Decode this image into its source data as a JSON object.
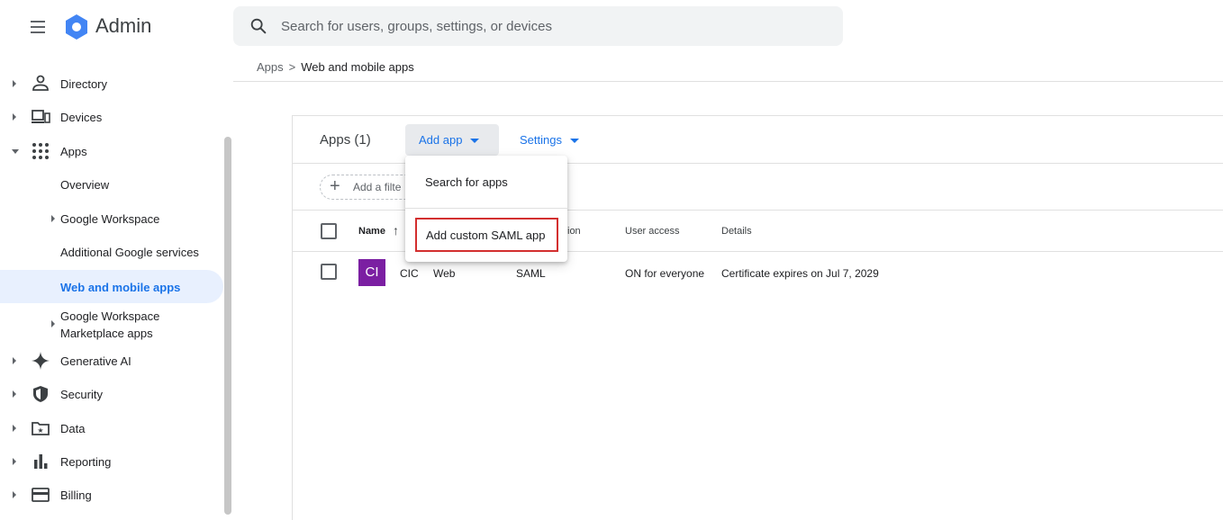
{
  "header": {
    "brand": "Admin",
    "search_placeholder": "Search for users, groups, settings, or devices"
  },
  "sidebar": {
    "items": [
      {
        "label": "Directory",
        "icon": "person-icon"
      },
      {
        "label": "Devices",
        "icon": "devices-icon"
      },
      {
        "label": "Apps",
        "icon": "apps-grid-icon",
        "expanded": true
      },
      {
        "label": "Generative AI",
        "icon": "sparkle-icon"
      },
      {
        "label": "Security",
        "icon": "shield-icon"
      },
      {
        "label": "Data",
        "icon": "data-folder-icon"
      },
      {
        "label": "Reporting",
        "icon": "bar-chart-icon"
      },
      {
        "label": "Billing",
        "icon": "billing-card-icon"
      }
    ],
    "apps_sub": [
      {
        "label": "Overview"
      },
      {
        "label": "Google Workspace"
      },
      {
        "label": "Additional Google services"
      },
      {
        "label": "Web and mobile apps",
        "active": true
      },
      {
        "label_line1": "Google Workspace",
        "label_line2": "Marketplace apps"
      }
    ]
  },
  "breadcrumb": {
    "parent": "Apps",
    "separator": ">",
    "current": "Web and mobile apps"
  },
  "apps_panel": {
    "count_label": "Apps (1)",
    "add_app_label": "Add app",
    "settings_label": "Settings",
    "filter_label": "Add a filte",
    "columns": {
      "name": "Name",
      "sort_arrow": "↑",
      "auth_partial": "ion",
      "user_access": "User access",
      "details": "Details"
    },
    "rows": [
      {
        "avatar": "CI",
        "name": "CIC",
        "name_suffix": "Web",
        "auth": "SAML",
        "user_access": "ON for everyone",
        "details": "Certificate expires on Jul 7, 2029"
      }
    ]
  },
  "add_app_menu": {
    "items": [
      {
        "label": "Search for apps"
      },
      {
        "label": "Add custom SAML app",
        "highlighted": true
      }
    ]
  },
  "colors": {
    "accent": "#1a73e8",
    "active_bg": "#e8f0fe",
    "avatar": "#7b1fa2",
    "highlight": "#d32f2f",
    "logo": "#4285f4"
  }
}
